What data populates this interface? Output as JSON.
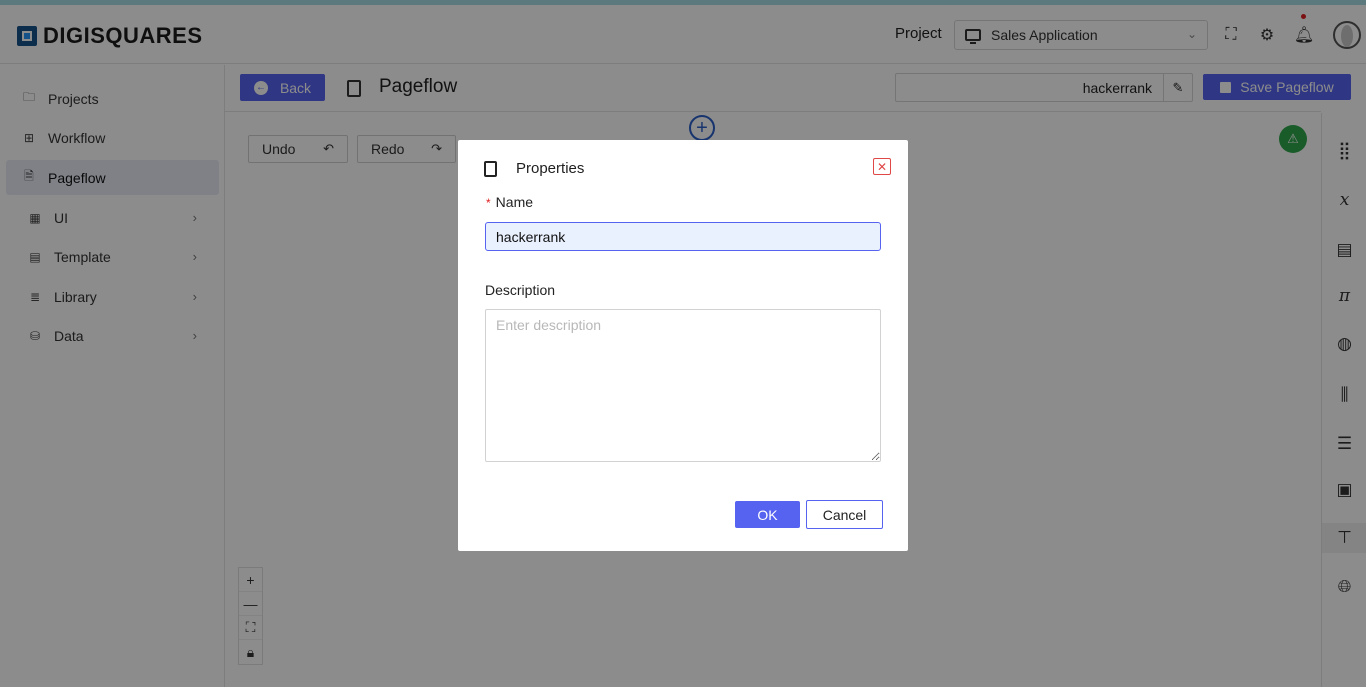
{
  "app": {
    "brand": "DIGISQUARES",
    "colors": {
      "accent": "#5663f0",
      "brand": "#16528a",
      "success": "#2fa84b",
      "danger": "#e04848"
    }
  },
  "header": {
    "project_label": "Project",
    "project_selected": "Sales Application",
    "icons": [
      "fullscreen-icon",
      "gear-icon",
      "bell-icon",
      "avatar"
    ]
  },
  "sidebar": {
    "items": [
      {
        "label": "Projects",
        "icon": "folder-icon"
      },
      {
        "label": "Workflow",
        "icon": "workflow-icon"
      },
      {
        "label": "Pageflow",
        "icon": "page-icon",
        "active": true
      },
      {
        "label": "UI",
        "icon": "grid-icon",
        "expandable": true
      },
      {
        "label": "Template",
        "icon": "template-icon",
        "expandable": true
      },
      {
        "label": "Library",
        "icon": "library-icon",
        "expandable": true
      },
      {
        "label": "Data",
        "icon": "database-icon",
        "expandable": true
      }
    ]
  },
  "toolbar": {
    "back_label": "Back",
    "page_title": "Pageflow",
    "pageflow_name": "hackerrank",
    "save_label": "Save Pageflow"
  },
  "canvas": {
    "undo_label": "Undo",
    "redo_label": "Redo",
    "zoom_in": "+",
    "zoom_out": "—"
  },
  "modal": {
    "title": "Properties",
    "name_label": "Name",
    "name_value": "hackerrank",
    "description_label": "Description",
    "description_placeholder": "Enter description",
    "ok_label": "OK",
    "cancel_label": "Cancel"
  }
}
